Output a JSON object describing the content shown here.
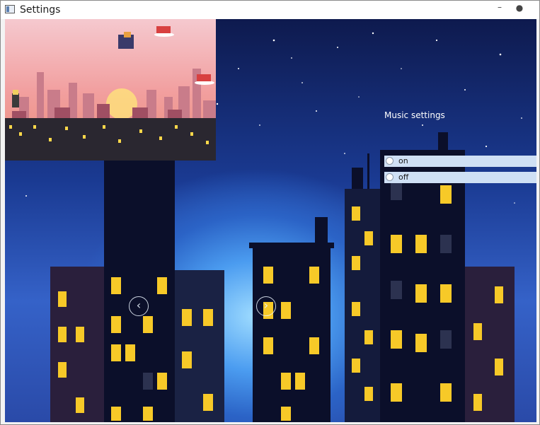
{
  "window": {
    "title": "Settings",
    "minimize_symbol": "–",
    "close_symbol": "●"
  },
  "music": {
    "label": "Music settings",
    "options": [
      "on",
      "off"
    ]
  },
  "carousel": {
    "prev_symbol": "‹",
    "next_symbol": "›"
  },
  "colors": {
    "window_lit": "#f7c928",
    "window_dark": "#2c3250",
    "building": "#0b0f2a",
    "accent_radio": "#cfe0f5"
  }
}
